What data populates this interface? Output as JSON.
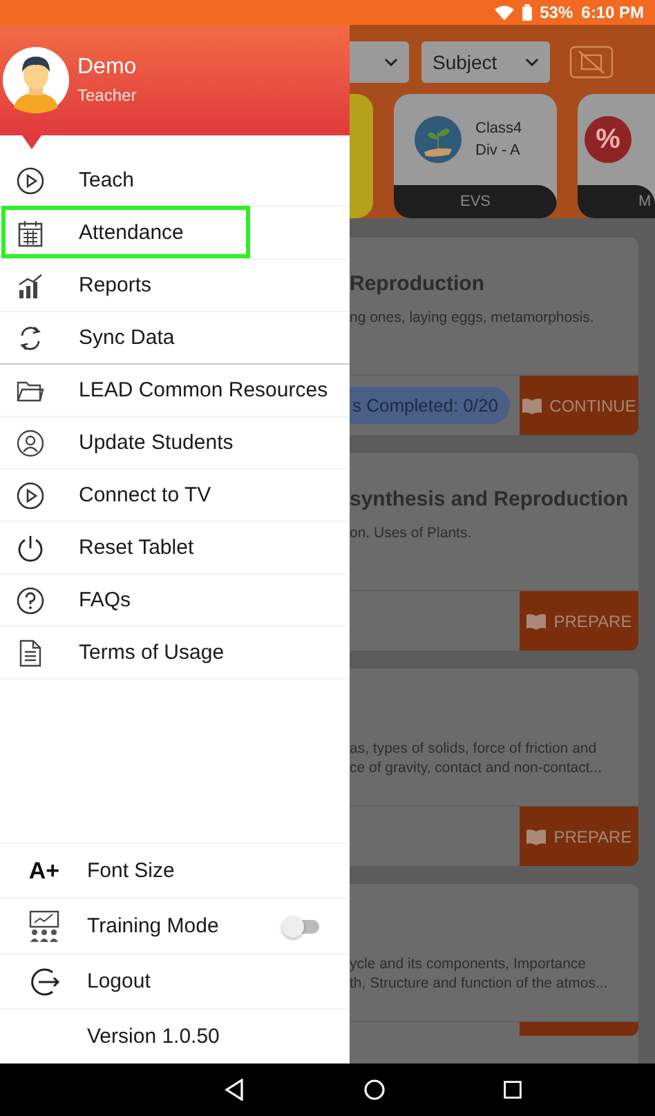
{
  "status_bar": {
    "battery": "53%",
    "time": "6:10 PM"
  },
  "background": {
    "dropdowns": [
      {
        "kind": "cut"
      },
      {
        "kind": "full",
        "label": "Subject"
      }
    ],
    "class_cards": [
      {
        "kind": "hidden",
        "color": "#b3a21a"
      },
      {
        "kind": "class",
        "color": "#2f5a78",
        "class": "Class4",
        "division": "Div - A",
        "subject": "EVS"
      },
      {
        "kind": "percent",
        "color": "#8e2424",
        "glyph": "%",
        "subject": "M"
      }
    ],
    "lessons": [
      {
        "title": "Reproduction",
        "description": [
          "ng ones, laying eggs, metamorphosis."
        ],
        "badge": "s Completed: 0/20",
        "button": "CONTINUE"
      },
      {
        "title": "synthesis and Reproduction",
        "description": [
          "on. Uses of Plants."
        ],
        "button": "PREPARE"
      },
      {
        "description": [
          "as, types of  solids, force of friction and",
          "ce of gravity, contact and non-contact..."
        ],
        "button": "PREPARE"
      },
      {
        "description": [
          "ycle and its components, Importance",
          "th, Structure and function of the atmos..."
        ]
      }
    ]
  },
  "drawer": {
    "user": {
      "name": "Demo",
      "role": "Teacher"
    },
    "menu": [
      {
        "label": "Teach",
        "highlighted": false,
        "divider": false
      },
      {
        "label": "Attendance",
        "highlighted": true,
        "divider": false
      },
      {
        "label": "Reports",
        "highlighted": false,
        "divider": false
      },
      {
        "label": "Sync Data",
        "highlighted": false,
        "divider": true
      },
      {
        "label": "LEAD Common Resources",
        "highlighted": false,
        "divider": false
      },
      {
        "label": "Update Students",
        "highlighted": false,
        "divider": false
      },
      {
        "label": "Connect to TV",
        "highlighted": false,
        "divider": false
      },
      {
        "label": "Reset Tablet",
        "highlighted": false,
        "divider": false
      },
      {
        "label": "FAQs",
        "highlighted": false,
        "divider": false
      },
      {
        "label": "Terms of Usage",
        "highlighted": false,
        "divider": false
      }
    ],
    "footer": [
      {
        "kind": "font",
        "glyph": "A+",
        "label": "Font Size"
      },
      {
        "kind": "training",
        "label": "Training Mode",
        "on": false
      },
      {
        "kind": "logout",
        "label": "Logout"
      },
      {
        "kind": "version",
        "label": "Version 1.0.50"
      }
    ]
  }
}
